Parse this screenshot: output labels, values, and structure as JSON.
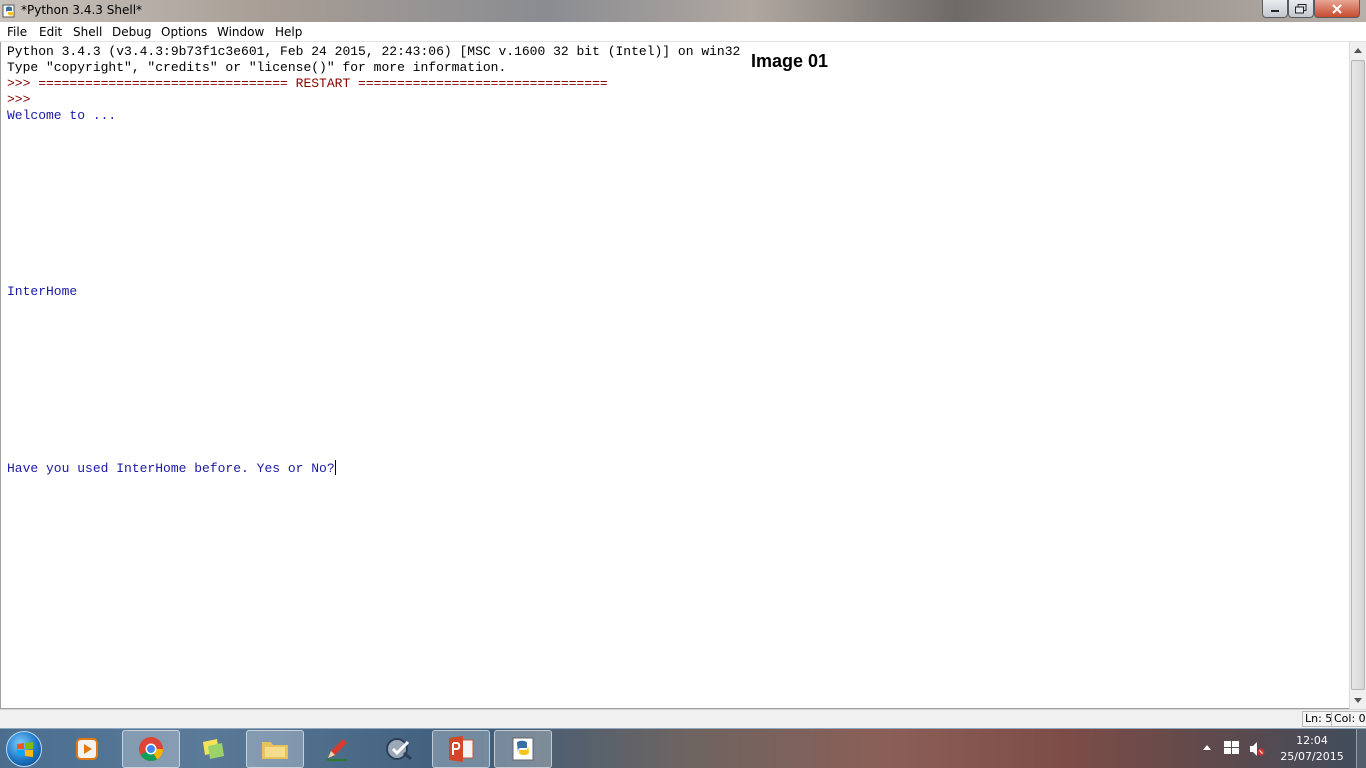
{
  "window": {
    "title": "*Python 3.4.3 Shell*",
    "icon": "idle-python-icon"
  },
  "menu": [
    "File",
    "Edit",
    "Shell",
    "Debug",
    "Options",
    "Window",
    "Help"
  ],
  "shell": {
    "lines": [
      "Python 3.4.3 (v3.4.3:9b73f1c3e601, Feb 24 2015, 22:43:06) [MSC v.1600 32 bit (Intel)] on win32",
      "Type \"copyright\", \"credits\" or \"license()\" for more information.",
      ">>> ================================ RESTART ================================",
      ">>> ",
      "Welcome to ...",
      "InterHome",
      "Have you used InterHome before. Yes or No?"
    ],
    "overlay_label": "Image 01"
  },
  "status": {
    "ln": "Ln: 5",
    "col": "Col: 0"
  },
  "taskbar": {
    "apps": [
      "start-button",
      "media-player-icon",
      "chrome-icon",
      "paint-tiles-icon",
      "file-explorer-icon",
      "pen-app-icon",
      "vpn-app-icon",
      "powerpoint-icon",
      "python-idle-icon"
    ],
    "time": "12:04",
    "date": "25/07/2015"
  },
  "colors": {
    "shell_output": "#1a1aa6",
    "prompt": "#8b0000",
    "text": "#000000"
  }
}
